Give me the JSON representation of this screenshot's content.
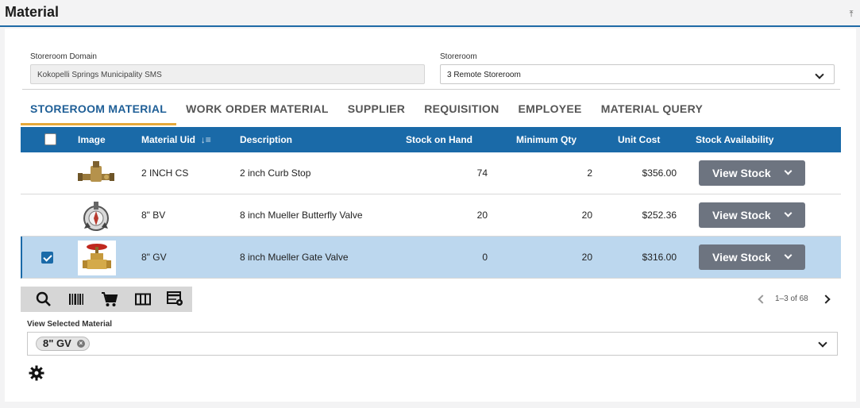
{
  "header": {
    "title": "Material"
  },
  "filters": {
    "storeroom_domain": {
      "label": "Storeroom Domain",
      "value": "Kokopelli Springs Municipality SMS"
    },
    "storeroom": {
      "label": "Storeroom",
      "value": "3 Remote Storeroom"
    }
  },
  "tabs": [
    {
      "label": "STOREROOM MATERIAL",
      "active": true
    },
    {
      "label": "WORK ORDER MATERIAL",
      "active": false
    },
    {
      "label": "SUPPLIER",
      "active": false
    },
    {
      "label": "REQUISITION",
      "active": false
    },
    {
      "label": "EMPLOYEE",
      "active": false
    },
    {
      "label": "MATERIAL QUERY",
      "active": false
    }
  ],
  "grid": {
    "columns": {
      "image": "Image",
      "uid": "Material Uid",
      "description": "Description",
      "stock": "Stock on Hand",
      "min_qty": "Minimum Qty",
      "unit_cost": "Unit Cost",
      "availability": "Stock Availability"
    },
    "rows": [
      {
        "uid": "2 INCH CS",
        "description": "2 inch Curb Stop",
        "stock": "74",
        "min_qty": "2",
        "unit_cost": "$356.00",
        "button": "View Stock",
        "selected": false,
        "image": "curb-stop-image"
      },
      {
        "uid": "8\" BV",
        "description": "8 inch Mueller Butterfly Valve",
        "stock": "20",
        "min_qty": "20",
        "unit_cost": "$252.36",
        "button": "View Stock",
        "selected": false,
        "image": "butterfly-valve-image"
      },
      {
        "uid": "8\" GV",
        "description": "8 inch Mueller Gate Valve",
        "stock": "0",
        "min_qty": "20",
        "unit_cost": "$316.00",
        "button": "View Stock",
        "selected": true,
        "image": "gate-valve-image"
      }
    ]
  },
  "toolbar": {
    "icons": [
      "search-icon",
      "barcode-icon",
      "cart-icon",
      "columns-icon",
      "grid-settings-icon"
    ]
  },
  "pager": {
    "text": "1–3 of 68"
  },
  "view_selected": {
    "label": "View Selected Material",
    "chip": "8\" GV"
  },
  "colors": {
    "header_blue": "#1a6aa8",
    "tab_underline": "#e6a93a",
    "selected_row": "#bcd7ee",
    "button_gray": "#6d7480"
  }
}
